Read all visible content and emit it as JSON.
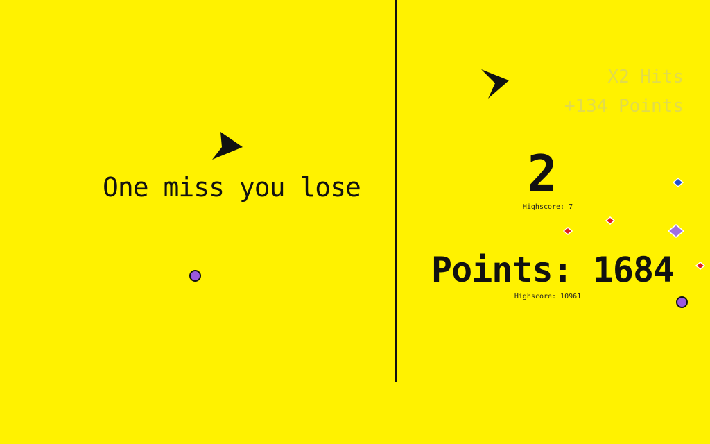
{
  "left_panel": {
    "tagline": "One miss you lose"
  },
  "right_panel": {
    "hits": "2",
    "hits_highscore": "Highscore: 7",
    "points": "Points: 1684",
    "points_highscore": "Highscore: 10961",
    "combo_hits": "X2 Hits",
    "combo_points": "+134 Points"
  },
  "colors": {
    "background": "#FFF200",
    "ball": "#9B59E0",
    "gem_red": "#E02020",
    "gem_blue": "#1F4FD0",
    "gem_purple": "#A070E0"
  },
  "icons": {
    "ship": "ship-icon",
    "ball": "ball-icon",
    "gem": "gem-icon"
  }
}
